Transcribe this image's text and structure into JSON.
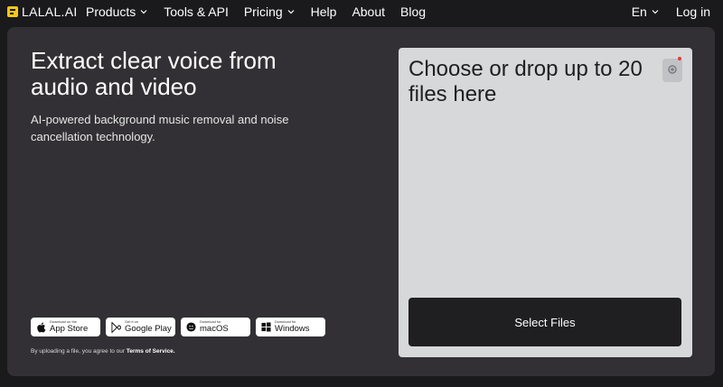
{
  "header": {
    "logo_text": "LALAL.AI",
    "nav": [
      {
        "label": "Products",
        "has_dropdown": true
      },
      {
        "label": "Tools & API",
        "has_dropdown": false
      },
      {
        "label": "Pricing",
        "has_dropdown": true
      },
      {
        "label": "Help",
        "has_dropdown": false
      },
      {
        "label": "About",
        "has_dropdown": false
      },
      {
        "label": "Blog",
        "has_dropdown": false
      }
    ],
    "language": "En",
    "login": "Log in"
  },
  "hero": {
    "headline": "Extract clear voice from audio and video",
    "subhead": "AI-powered background music removal and noise cancellation technology."
  },
  "stores": [
    {
      "small": "Download on the",
      "big": "App Store",
      "icon": "apple-icon"
    },
    {
      "small": "Get it on",
      "big": "Google Play",
      "icon": "google-play-icon"
    },
    {
      "small": "Download for",
      "big": "macOS",
      "icon": "macos-icon"
    },
    {
      "small": "Download for",
      "big": "Windows",
      "icon": "windows-icon"
    }
  ],
  "terms": {
    "text": "By uploading a file, you agree to our",
    "link": "Terms of Service."
  },
  "dropzone": {
    "title": "Choose or drop up to 20 files here",
    "select_button": "Select Files",
    "record_icon": "record-icon"
  },
  "colors": {
    "page_bg": "#1a191c",
    "panel_bg": "#323034",
    "dropzone_bg": "#d6d8da",
    "button_bg": "#1f1e21",
    "logo_accent": "#f5c518",
    "record_dot": "#e53935"
  }
}
